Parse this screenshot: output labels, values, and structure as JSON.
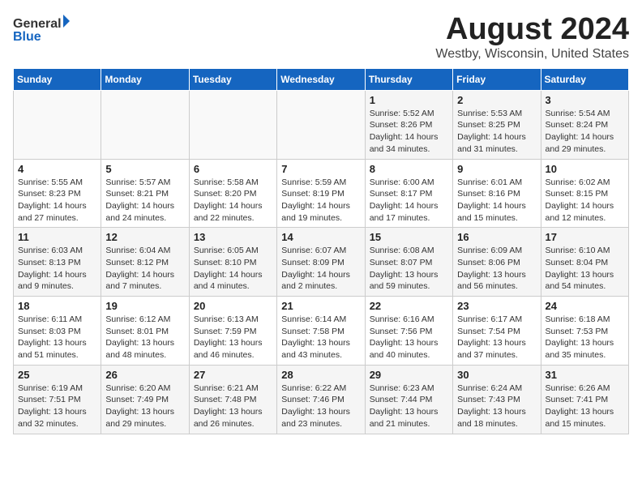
{
  "header": {
    "logo_general": "General",
    "logo_blue": "Blue",
    "title": "August 2024",
    "subtitle": "Westby, Wisconsin, United States"
  },
  "calendar": {
    "days_of_week": [
      "Sunday",
      "Monday",
      "Tuesday",
      "Wednesday",
      "Thursday",
      "Friday",
      "Saturday"
    ],
    "weeks": [
      [
        {
          "day": "",
          "detail": ""
        },
        {
          "day": "",
          "detail": ""
        },
        {
          "day": "",
          "detail": ""
        },
        {
          "day": "",
          "detail": ""
        },
        {
          "day": "1",
          "detail": "Sunrise: 5:52 AM\nSunset: 8:26 PM\nDaylight: 14 hours\nand 34 minutes."
        },
        {
          "day": "2",
          "detail": "Sunrise: 5:53 AM\nSunset: 8:25 PM\nDaylight: 14 hours\nand 31 minutes."
        },
        {
          "day": "3",
          "detail": "Sunrise: 5:54 AM\nSunset: 8:24 PM\nDaylight: 14 hours\nand 29 minutes."
        }
      ],
      [
        {
          "day": "4",
          "detail": "Sunrise: 5:55 AM\nSunset: 8:23 PM\nDaylight: 14 hours\nand 27 minutes."
        },
        {
          "day": "5",
          "detail": "Sunrise: 5:57 AM\nSunset: 8:21 PM\nDaylight: 14 hours\nand 24 minutes."
        },
        {
          "day": "6",
          "detail": "Sunrise: 5:58 AM\nSunset: 8:20 PM\nDaylight: 14 hours\nand 22 minutes."
        },
        {
          "day": "7",
          "detail": "Sunrise: 5:59 AM\nSunset: 8:19 PM\nDaylight: 14 hours\nand 19 minutes."
        },
        {
          "day": "8",
          "detail": "Sunrise: 6:00 AM\nSunset: 8:17 PM\nDaylight: 14 hours\nand 17 minutes."
        },
        {
          "day": "9",
          "detail": "Sunrise: 6:01 AM\nSunset: 8:16 PM\nDaylight: 14 hours\nand 15 minutes."
        },
        {
          "day": "10",
          "detail": "Sunrise: 6:02 AM\nSunset: 8:15 PM\nDaylight: 14 hours\nand 12 minutes."
        }
      ],
      [
        {
          "day": "11",
          "detail": "Sunrise: 6:03 AM\nSunset: 8:13 PM\nDaylight: 14 hours\nand 9 minutes."
        },
        {
          "day": "12",
          "detail": "Sunrise: 6:04 AM\nSunset: 8:12 PM\nDaylight: 14 hours\nand 7 minutes."
        },
        {
          "day": "13",
          "detail": "Sunrise: 6:05 AM\nSunset: 8:10 PM\nDaylight: 14 hours\nand 4 minutes."
        },
        {
          "day": "14",
          "detail": "Sunrise: 6:07 AM\nSunset: 8:09 PM\nDaylight: 14 hours\nand 2 minutes."
        },
        {
          "day": "15",
          "detail": "Sunrise: 6:08 AM\nSunset: 8:07 PM\nDaylight: 13 hours\nand 59 minutes."
        },
        {
          "day": "16",
          "detail": "Sunrise: 6:09 AM\nSunset: 8:06 PM\nDaylight: 13 hours\nand 56 minutes."
        },
        {
          "day": "17",
          "detail": "Sunrise: 6:10 AM\nSunset: 8:04 PM\nDaylight: 13 hours\nand 54 minutes."
        }
      ],
      [
        {
          "day": "18",
          "detail": "Sunrise: 6:11 AM\nSunset: 8:03 PM\nDaylight: 13 hours\nand 51 minutes."
        },
        {
          "day": "19",
          "detail": "Sunrise: 6:12 AM\nSunset: 8:01 PM\nDaylight: 13 hours\nand 48 minutes."
        },
        {
          "day": "20",
          "detail": "Sunrise: 6:13 AM\nSunset: 7:59 PM\nDaylight: 13 hours\nand 46 minutes."
        },
        {
          "day": "21",
          "detail": "Sunrise: 6:14 AM\nSunset: 7:58 PM\nDaylight: 13 hours\nand 43 minutes."
        },
        {
          "day": "22",
          "detail": "Sunrise: 6:16 AM\nSunset: 7:56 PM\nDaylight: 13 hours\nand 40 minutes."
        },
        {
          "day": "23",
          "detail": "Sunrise: 6:17 AM\nSunset: 7:54 PM\nDaylight: 13 hours\nand 37 minutes."
        },
        {
          "day": "24",
          "detail": "Sunrise: 6:18 AM\nSunset: 7:53 PM\nDaylight: 13 hours\nand 35 minutes."
        }
      ],
      [
        {
          "day": "25",
          "detail": "Sunrise: 6:19 AM\nSunset: 7:51 PM\nDaylight: 13 hours\nand 32 minutes."
        },
        {
          "day": "26",
          "detail": "Sunrise: 6:20 AM\nSunset: 7:49 PM\nDaylight: 13 hours\nand 29 minutes."
        },
        {
          "day": "27",
          "detail": "Sunrise: 6:21 AM\nSunset: 7:48 PM\nDaylight: 13 hours\nand 26 minutes."
        },
        {
          "day": "28",
          "detail": "Sunrise: 6:22 AM\nSunset: 7:46 PM\nDaylight: 13 hours\nand 23 minutes."
        },
        {
          "day": "29",
          "detail": "Sunrise: 6:23 AM\nSunset: 7:44 PM\nDaylight: 13 hours\nand 21 minutes."
        },
        {
          "day": "30",
          "detail": "Sunrise: 6:24 AM\nSunset: 7:43 PM\nDaylight: 13 hours\nand 18 minutes."
        },
        {
          "day": "31",
          "detail": "Sunrise: 6:26 AM\nSunset: 7:41 PM\nDaylight: 13 hours\nand 15 minutes."
        }
      ]
    ]
  }
}
